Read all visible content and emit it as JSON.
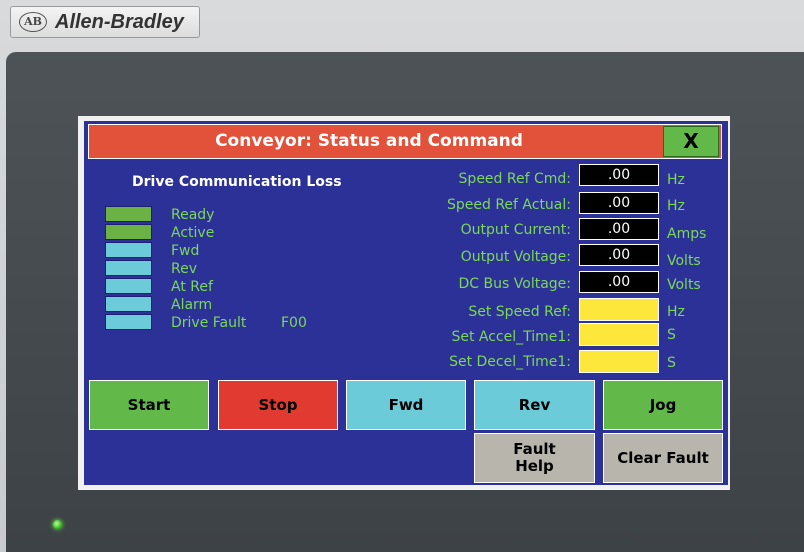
{
  "brand": {
    "logo_text": "AB",
    "name": "Allen-Bradley"
  },
  "window": {
    "title": "Conveyor: Status and Command",
    "close_label": "X"
  },
  "status_message": "Drive Communication Loss",
  "indicators": [
    {
      "label": "Ready",
      "color": "#6cb144"
    },
    {
      "label": "Active",
      "color": "#6cb144"
    },
    {
      "label": "Fwd",
      "color": "#6ccbd9"
    },
    {
      "label": "Rev",
      "color": "#6ccbd9"
    },
    {
      "label": "At Ref",
      "color": "#6ccbd9"
    },
    {
      "label": "Alarm",
      "color": "#6ccbd9"
    },
    {
      "label": "Drive Fault",
      "color": "#6ccbd9",
      "code": "F00"
    }
  ],
  "readouts": [
    {
      "label": "Speed Ref Cmd:",
      "value": ".00",
      "unit": "Hz"
    },
    {
      "label": "Speed Ref Actual:",
      "value": ".00",
      "unit": "Hz"
    },
    {
      "label": "Output Current:",
      "value": ".00",
      "unit": "Amps"
    },
    {
      "label": "Output Voltage:",
      "value": ".00",
      "unit": "Volts"
    },
    {
      "label": "DC Bus Voltage:",
      "value": ".00",
      "unit": "Volts"
    }
  ],
  "setpoints": [
    {
      "label": "Set Speed Ref:",
      "value": "",
      "unit": "Hz"
    },
    {
      "label": "Set Accel_Time1:",
      "value": "",
      "unit": "S"
    },
    {
      "label": "Set Decel_Time1:",
      "value": "",
      "unit": "S"
    }
  ],
  "buttons": {
    "start": "Start",
    "stop": "Stop",
    "fwd": "Fwd",
    "rev": "Rev",
    "jog": "Jog",
    "fault_help_line1": "Fault",
    "fault_help_line2": "Help",
    "clear_fault": "Clear Fault"
  },
  "colors": {
    "panel": "#2b3196",
    "title_bar": "#e2513a",
    "label_text": "#7cd957",
    "start": "#62b849",
    "stop": "#e03a31",
    "direction": "#6ccbd9",
    "jog": "#62b849",
    "fault": "#b8b6ac",
    "setpoint": "#fde73a",
    "status_led": "#39c21d"
  }
}
